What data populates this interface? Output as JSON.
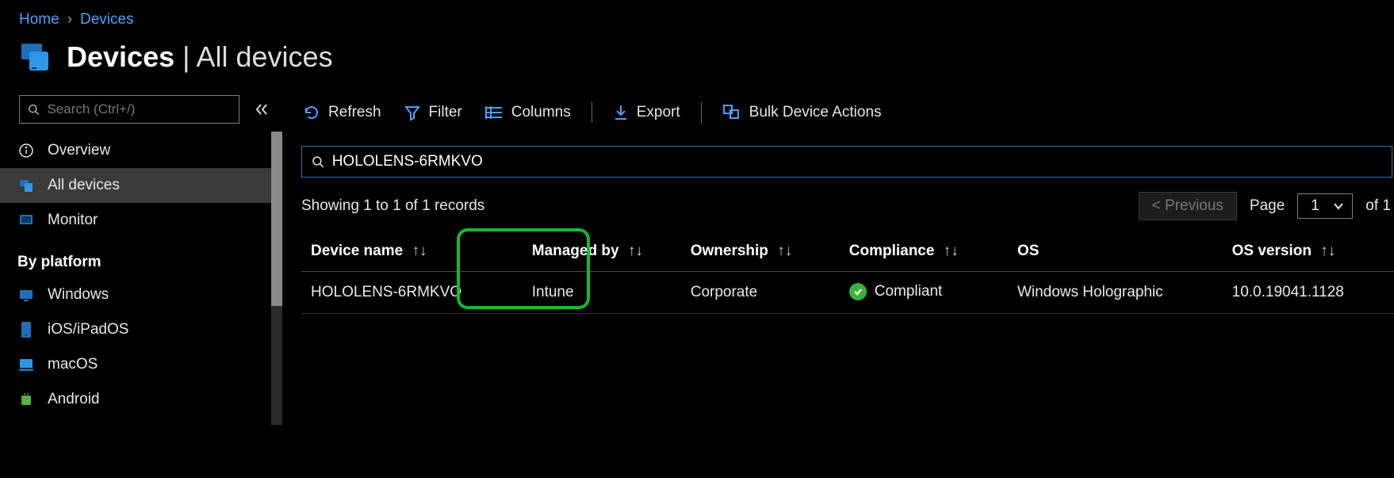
{
  "breadcrumb": {
    "home": "Home",
    "devices": "Devices"
  },
  "title": {
    "bold": "Devices",
    "sep": "|",
    "thin": "All devices"
  },
  "sidebar": {
    "search_placeholder": "Search (Ctrl+/)",
    "items": {
      "overview": "Overview",
      "all_devices": "All devices",
      "monitor": "Monitor"
    },
    "section": "By platform",
    "platforms": {
      "windows": "Windows",
      "ios": "iOS/iPadOS",
      "macos": "macOS",
      "android": "Android"
    }
  },
  "toolbar": {
    "refresh": "Refresh",
    "filter": "Filter",
    "columns": "Columns",
    "export": "Export",
    "bulk": "Bulk Device Actions"
  },
  "filter": {
    "value": "HOLOLENS-6RMKVO"
  },
  "records": {
    "text": "Showing 1 to 1 of 1 records",
    "previous": "<  Previous",
    "page_label": "Page",
    "page_value": "1",
    "of_text": "of 1"
  },
  "table": {
    "headers": {
      "device_name": "Device name",
      "managed_by": "Managed by",
      "ownership": "Ownership",
      "compliance": "Compliance",
      "os": "OS",
      "os_version": "OS version"
    },
    "row": {
      "device_name": "HOLOLENS-6RMKVO",
      "managed_by": "Intune",
      "ownership": "Corporate",
      "compliance": "Compliant",
      "os": "Windows Holographic",
      "os_version": "10.0.19041.1128"
    }
  }
}
